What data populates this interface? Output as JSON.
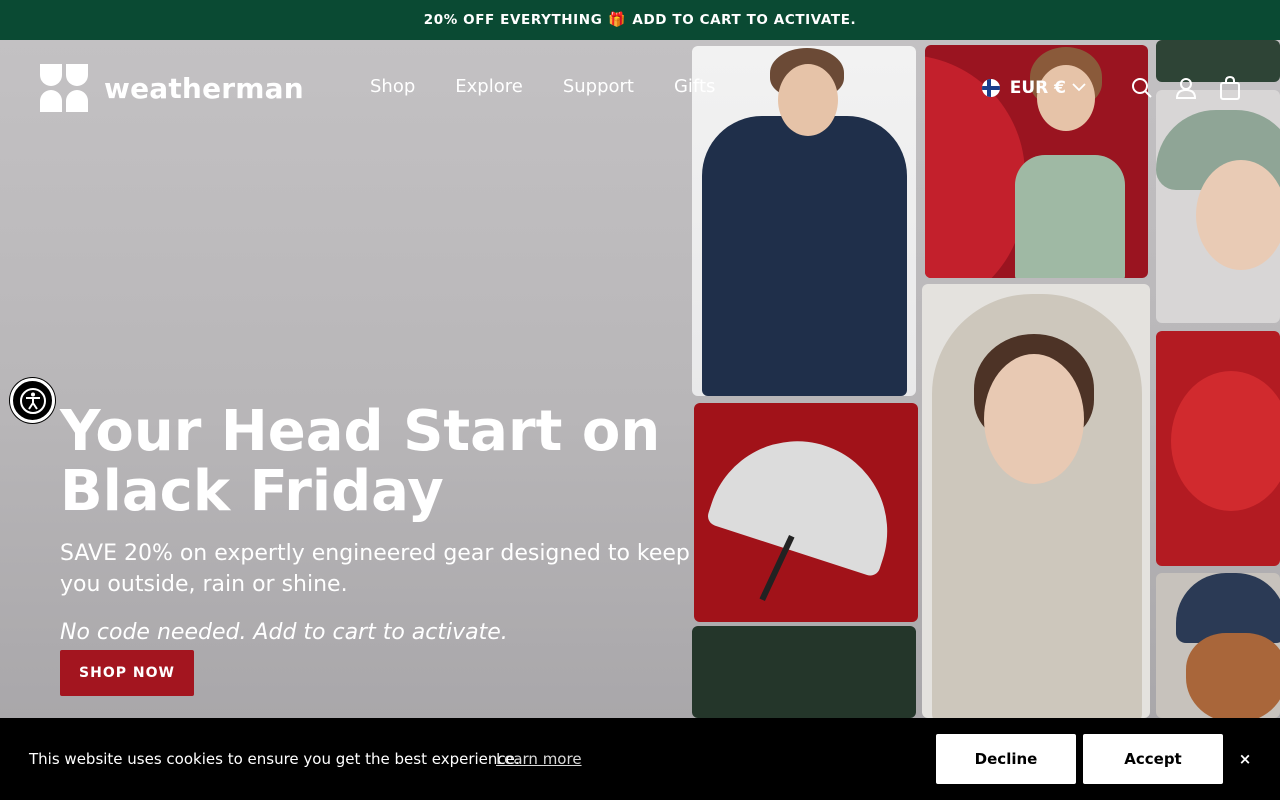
{
  "announcement": {
    "bold": "20% OFF EVERYTHING",
    "gift_icon": "🎁",
    "rest": "ADD TO CART TO ACTIVATE."
  },
  "header": {
    "logo_text": "weatherman",
    "nav": [
      "Shop",
      "Explore",
      "Support",
      "Gifts"
    ],
    "currency": "EUR €",
    "icons": [
      "finland-flag-icon",
      "chevron-down-icon",
      "search-icon",
      "account-icon",
      "bag-icon"
    ]
  },
  "hero": {
    "title_line1": "Your Head Start on",
    "title_line2": "Black Friday",
    "subtitle": "SAVE 20% on expertly engineered gear designed to keep you outside, rain or shine.",
    "note": "No code needed. Add to cart to activate.",
    "cta": "SHOP NOW"
  },
  "cookie": {
    "message": "This website uses cookies to ensure you get the best experience.",
    "link": "Learn more",
    "decline": "Decline",
    "accept": "Accept",
    "close": "×"
  },
  "colors": {
    "announce_bg": "#0a4a33",
    "cta_bg": "#a3151f",
    "cookie_bg": "#000000"
  }
}
